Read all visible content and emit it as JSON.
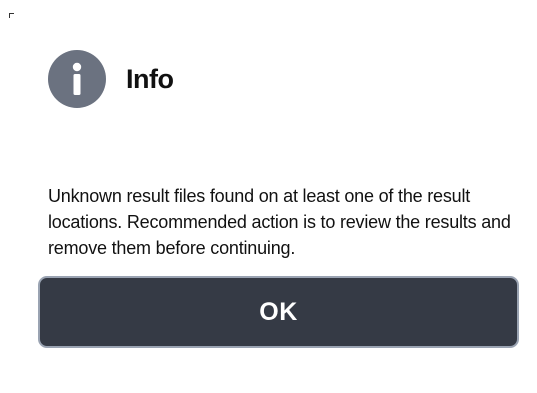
{
  "dialog": {
    "icon": "info-icon",
    "title": "Info",
    "message": "Unknown result files found on at least one of the result locations. Recommended action is to review the results and remove them before continuing.",
    "ok_label": "OK"
  },
  "colors": {
    "icon_bg": "#6b7280",
    "button_bg": "#353a45",
    "button_border": "#9aa3b2",
    "text": "#111111"
  }
}
